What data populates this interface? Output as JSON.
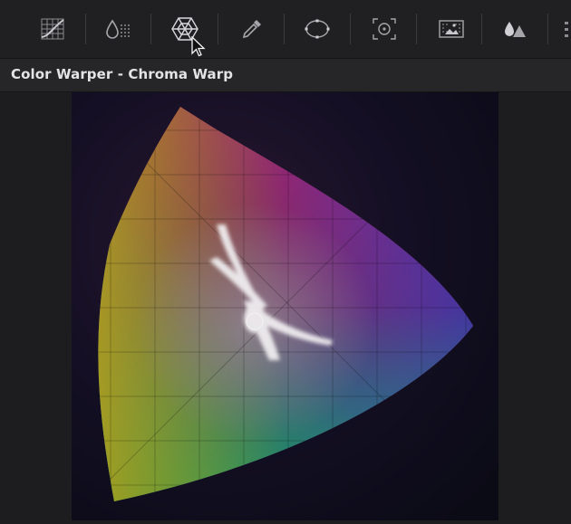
{
  "panel": {
    "title": "Color Warper - Chroma Warp"
  },
  "toolbar": {
    "tools": [
      {
        "name": "curves-tool",
        "icon": "curves-grid-icon",
        "active": false
      },
      {
        "name": "hue-sat-tool",
        "icon": "droplet-dots-icon",
        "active": false
      },
      {
        "name": "color-warper-tool",
        "icon": "warp-mesh-icon",
        "active": true
      },
      {
        "name": "qualifier-tool",
        "icon": "eyedropper-icon",
        "active": false
      },
      {
        "name": "window-tool",
        "icon": "ellipse-window-icon",
        "active": false
      },
      {
        "name": "tracker-tool",
        "icon": "target-crosshair-icon",
        "active": false
      },
      {
        "name": "blur-tool",
        "icon": "image-dots-icon",
        "active": false
      },
      {
        "name": "key-tool",
        "icon": "drop-triangle-icon",
        "active": false
      }
    ]
  },
  "colors": {
    "toolbar_bg": "#202022",
    "icon": "#a6a6aa",
    "icon_active": "#d8d8dc",
    "title_text": "#e4e4e6",
    "canvas_bg": "#0b0b13"
  }
}
